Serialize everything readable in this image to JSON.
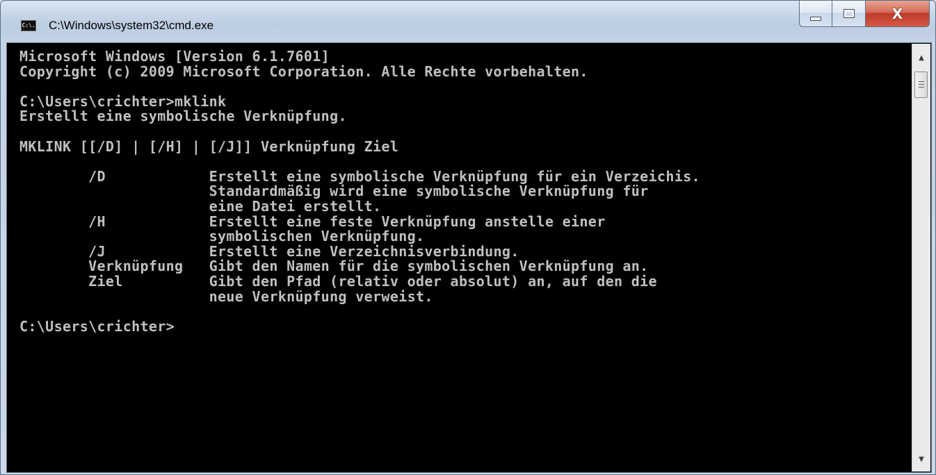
{
  "window": {
    "title": "C:\\Windows\\system32\\cmd.exe",
    "icon_text": "C:\\.",
    "icon": "cmd-console-icon",
    "buttons": {
      "minimize_icon": "minimize-icon",
      "maximize_icon": "maximize-icon",
      "close_icon": "close-icon",
      "close_glyph": "X"
    }
  },
  "console": {
    "lines": [
      "Microsoft Windows [Version 6.1.7601]",
      "Copyright (c) 2009 Microsoft Corporation. Alle Rechte vorbehalten.",
      "",
      "C:\\Users\\crichter>mklink",
      "Erstellt eine symbolische Verknüpfung.",
      "",
      "MKLINK [[/D] | [/H] | [/J]] Verknüpfung Ziel",
      "",
      "        /D            Erstellt eine symbolische Verknüpfung für ein Verzeichis.",
      "                      Standardmäßig wird eine symbolische Verknüpfung für",
      "                      eine Datei erstellt.",
      "        /H            Erstellt eine feste Verknüpfung anstelle einer",
      "                      symbolischen Verknüpfung.",
      "        /J            Erstellt eine Verzeichnisverbindung.",
      "        Verknüpfung   Gibt den Namen für die symbolischen Verknüpfung an.",
      "        Ziel          Gibt den Pfad (relativ oder absolut) an, auf den die",
      "                      neue Verknüpfung verweist.",
      "",
      "C:\\Users\\crichter>"
    ],
    "text_color": "#c0c0c0",
    "background_color": "#000000"
  },
  "scrollbar": {
    "up_glyph": "▲",
    "down_glyph": "▼"
  },
  "colors": {
    "close_button": "#c0392b",
    "frame": "#c7d6e8"
  }
}
